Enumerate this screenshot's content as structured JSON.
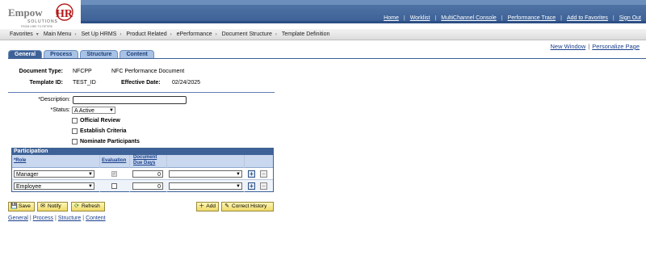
{
  "logo": {
    "text_a": "Empow",
    "text_b": "HR",
    "sub": "SOLUTIONS",
    "tagline": "FROM HIRE TO RETIRE"
  },
  "toplinks": [
    "Home",
    "Worklist",
    "MultiChannel Console",
    "Performance Trace",
    "Add to Favorites",
    "Sign Out"
  ],
  "breadcrumb": [
    "Favorites",
    "Main Menu",
    "Set Up HRMS",
    "Product Related",
    "ePerformance",
    "Document Structure",
    "Template Definition"
  ],
  "rightlinks": {
    "new_window": "New Window",
    "personalize": "Personalize Page"
  },
  "tabs": [
    "General",
    "Process",
    "Structure",
    "Content"
  ],
  "form": {
    "doc_type_label": "Document Type:",
    "doc_type_code": "NFCPP",
    "doc_type_desc": "NFC Performance Document",
    "template_id_label": "Template ID:",
    "template_id": "TEST_ID",
    "eff_date_label": "Effective Date:",
    "eff_date": "02/24/2025",
    "description_label": "*Description:",
    "description_value": "",
    "status_label": "*Status:",
    "status_value": "A Active",
    "official_review": "Official Review",
    "establish_criteria": "Establish Criteria",
    "nominate_participants": "Nominate Participants"
  },
  "grid": {
    "title": "Participation",
    "headers": {
      "role": "*Role",
      "evaluation": "Evaluation",
      "due_days_1": "Document",
      "due_days_2": "Due Days"
    },
    "rows": [
      {
        "role": "Manager",
        "evaluation_checked": true,
        "due_days": "0",
        "extra": ""
      },
      {
        "role": "Employee",
        "evaluation_checked": false,
        "due_days": "0",
        "extra": ""
      }
    ]
  },
  "buttons": {
    "save": "Save",
    "notify": "Notify",
    "refresh": "Refresh",
    "add": "Add",
    "correct_history": "Correct History"
  },
  "bottomlinks": [
    "General",
    "Process",
    "Structure",
    "Content"
  ]
}
